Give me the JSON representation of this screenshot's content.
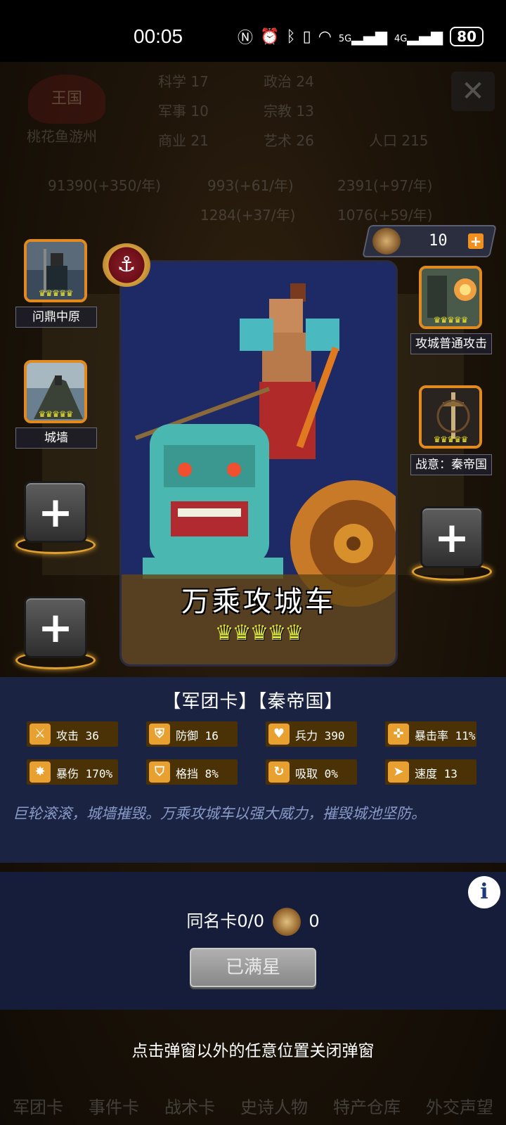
{
  "status_bar": {
    "time": "00:05",
    "icons": [
      "nfc-icon",
      "alarm-icon",
      "bluetooth-icon",
      "vibrate-icon",
      "wifi-icon",
      "5g-signal-icon",
      "4g-signal-icon"
    ],
    "signal_5g": "5G",
    "signal_4g": "4G",
    "battery": "80"
  },
  "background": {
    "kingdom_emblem": "王国",
    "player_name": "桃花鱼游州",
    "stats": [
      {
        "label": "科学",
        "value": "17"
      },
      {
        "label": "政治",
        "value": "24"
      },
      {
        "label": "军事",
        "value": "10"
      },
      {
        "label": "宗教",
        "value": "13"
      },
      {
        "label": "商业",
        "value": "21"
      },
      {
        "label": "艺术",
        "value": "26"
      },
      {
        "label": "人口",
        "value": "215"
      }
    ],
    "resources": [
      "91390(+350/年)",
      "993(+61/年)",
      "2391(+97/年)",
      "1284(+37/年)",
      "1076(+59/年)"
    ],
    "bottom_nav": [
      "军团卡",
      "事件卡",
      "战术卡",
      "史诗人物",
      "特产仓库",
      "外交声望"
    ]
  },
  "modal": {
    "resource_count": "10",
    "left_slots": [
      {
        "label": "问鼎中原",
        "stars": "♛♛♛♛♛"
      },
      {
        "label": "城墙",
        "stars": "♛♛♛♛♛"
      }
    ],
    "right_slots": [
      {
        "label": "攻城普通攻击",
        "stars": "♛♛♛♛♛"
      },
      {
        "label": "战意：秦帝国",
        "stars": "♛♛♛♛♛"
      }
    ],
    "hero": {
      "name": "万乘攻城车",
      "stars": "♛♛♛♛♛",
      "badge_icon": "anchor-icon"
    },
    "tags": "【军团卡】【秦帝国】",
    "stats": [
      {
        "icon": "sword-icon",
        "label": "攻击 36"
      },
      {
        "icon": "shield-icon",
        "label": "防御 16"
      },
      {
        "icon": "heart-icon",
        "label": "兵力 390"
      },
      {
        "icon": "crit-icon",
        "label": "暴击率 11%"
      },
      {
        "icon": "crit-damage-icon",
        "label": "暴伤 170%"
      },
      {
        "icon": "block-icon",
        "label": "格挡 8%"
      },
      {
        "icon": "lifesteal-icon",
        "label": "吸取 0%"
      },
      {
        "icon": "speed-icon",
        "label": "速度 13"
      }
    ],
    "description": "巨轮滚滚，城墙摧毁。万乘攻城车以强大威力，摧毁城池坚防。",
    "duplicate_label": "同名卡0/0",
    "duplicate_medal_count": "0",
    "max_star_button": "已满星",
    "close_hint": "点击弹窗以外的任意位置关闭弹窗"
  }
}
